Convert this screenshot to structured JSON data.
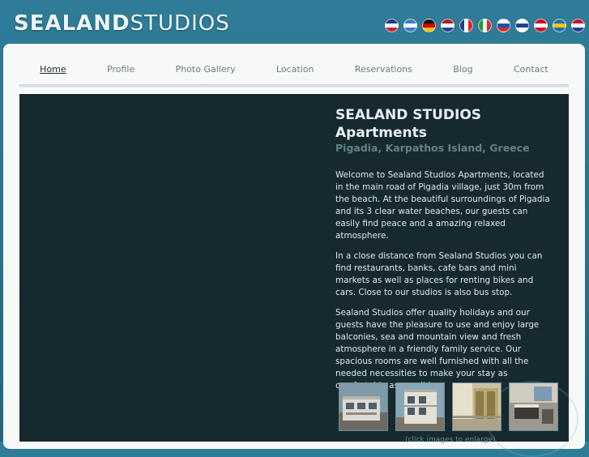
{
  "header": {
    "logo_bold": "SEALAND",
    "logo_light": "STUDIOS",
    "flags": [
      {
        "name": "uk-flag-icon",
        "colors": [
          "#1f3f8c",
          "#ffffff",
          "#cc2233"
        ]
      },
      {
        "name": "greece-flag-icon",
        "colors": [
          "#3d7cc9",
          "#ffffff",
          "#3d7cc9"
        ]
      },
      {
        "name": "germany-flag-icon",
        "colors": [
          "#111111",
          "#d00000",
          "#f2c200"
        ]
      },
      {
        "name": "netherlands-flag-icon",
        "colors": [
          "#ae1c28",
          "#ffffff",
          "#21468b"
        ]
      },
      {
        "name": "france-flag-icon",
        "colors": [
          "#1b3f8f",
          "#ffffff",
          "#d82a2a"
        ]
      },
      {
        "name": "italy-flag-icon",
        "colors": [
          "#1a9a3a",
          "#ffffff",
          "#d82a2a"
        ]
      },
      {
        "name": "russia-flag-icon",
        "colors": [
          "#ffffff",
          "#1f4fa8",
          "#d82a2a"
        ]
      },
      {
        "name": "finland-flag-icon",
        "colors": [
          "#ffffff",
          "#1c3f95",
          "#ffffff"
        ]
      },
      {
        "name": "denmark-flag-icon",
        "colors": [
          "#c8102e",
          "#ffffff",
          "#c8102e"
        ]
      },
      {
        "name": "sweden-flag-icon",
        "colors": [
          "#1e6fb8",
          "#f7c600",
          "#1e6fb8"
        ]
      },
      {
        "name": "norway-flag-icon",
        "colors": [
          "#c8102e",
          "#ffffff",
          "#1c3f95"
        ]
      }
    ]
  },
  "nav": {
    "items": [
      "Home",
      "Profile",
      "Photo Gallery",
      "Location",
      "Reservations",
      "Blog",
      "Contact"
    ],
    "active": "Home"
  },
  "main": {
    "title": "SEALAND STUDIOS Apartments",
    "subtitle": "Pigadia, Karpathos Island, Greece",
    "paragraphs": [
      "Welcome to Sealand Studios Apartments, located in the main road of Pigadia village, just 30m from the beach. At the beautiful surroundings of Pigadia and its 3 clear water beaches, our guests can easily find peace and a amazing relaxed atmosphere.",
      "In a close distance from Sealand Studios you can find restaurants, banks, cafe bars and mini markets as well as places for renting bikes and cars. Close to our studios is also bus stop.",
      "Sealand Studios offer quality holidays and our guests have the pleasure to use and enjoy large balconies, sea and mountain view and fresh atmosphere in a friendly family service. Our spacious rooms are well furnished with all the needed necessities to make your stay as comfortable as possible."
    ],
    "thumbs": [
      "building-photo-1",
      "building-photo-2",
      "balcony-photo",
      "room-photo"
    ],
    "thumb_caption": "(click images to enlarge)"
  }
}
